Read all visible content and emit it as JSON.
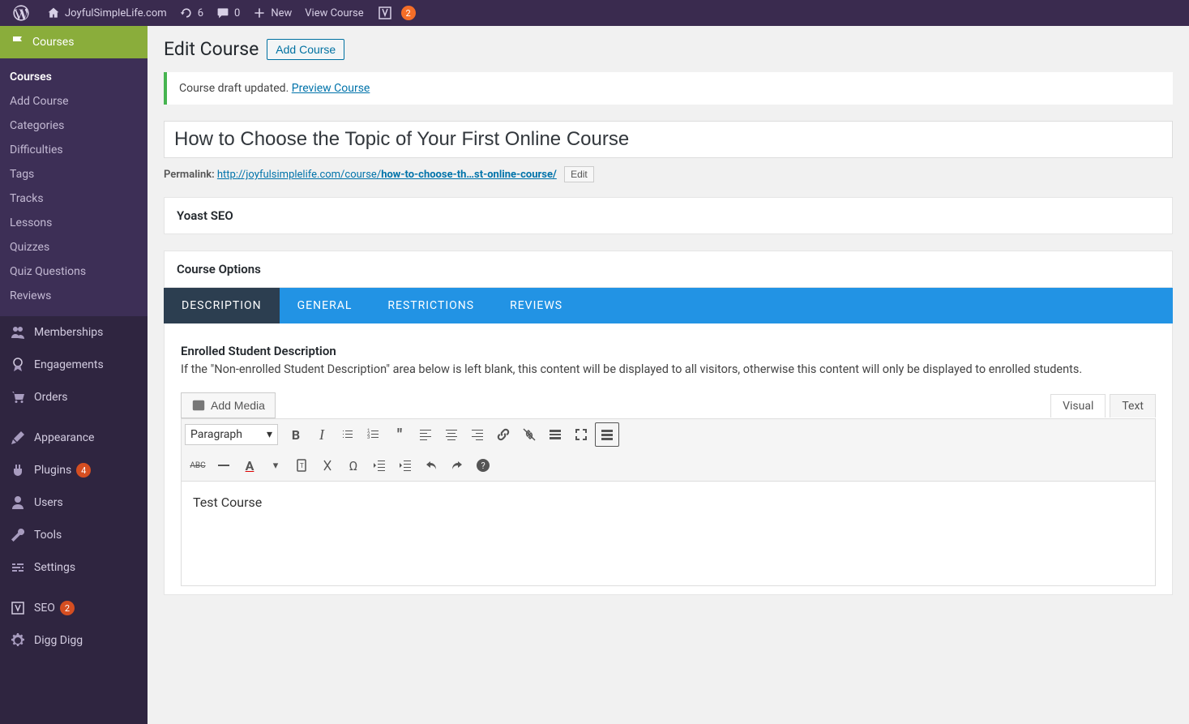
{
  "adminbar": {
    "site_name": "JoyfulSimpleLife.com",
    "updates_count": "6",
    "comments_count": "0",
    "new_label": "New",
    "view_label": "View Course",
    "yoast_count": "2"
  },
  "sidebar": {
    "current_menu": "Courses",
    "submenu": [
      {
        "label": "Courses",
        "current": true
      },
      {
        "label": "Add Course"
      },
      {
        "label": "Categories"
      },
      {
        "label": "Difficulties"
      },
      {
        "label": "Tags"
      },
      {
        "label": "Tracks"
      },
      {
        "label": "Lessons"
      },
      {
        "label": "Quizzes"
      },
      {
        "label": "Quiz Questions"
      },
      {
        "label": "Reviews"
      }
    ],
    "items": [
      {
        "icon": "users",
        "label": "Memberships"
      },
      {
        "icon": "award",
        "label": "Engagements"
      },
      {
        "icon": "cart",
        "label": "Orders"
      },
      {
        "sep": true
      },
      {
        "icon": "brush",
        "label": "Appearance"
      },
      {
        "icon": "plug",
        "label": "Plugins",
        "badge": "4"
      },
      {
        "icon": "user",
        "label": "Users"
      },
      {
        "icon": "wrench",
        "label": "Tools"
      },
      {
        "icon": "sliders",
        "label": "Settings"
      },
      {
        "sep": true
      },
      {
        "icon": "yoast",
        "label": "SEO",
        "badge": "2"
      },
      {
        "icon": "gear",
        "label": "Digg Digg"
      }
    ]
  },
  "page": {
    "heading": "Edit Course",
    "add_label": "Add Course",
    "notice_text": "Course draft updated. ",
    "notice_link": "Preview Course",
    "title_value": "How to Choose the Topic of Your First Online Course",
    "permalink_label": "Permalink:",
    "permalink_url_base": "http://joyfulsimplelife.com/course/",
    "permalink_slug": "how-to-choose-th…st-online-course/",
    "permalink_edit": "Edit"
  },
  "metaboxes": {
    "yoast_title": "Yoast SEO",
    "options_title": "Course Options"
  },
  "tabs": [
    {
      "label": "DESCRIPTION",
      "active": true
    },
    {
      "label": "GENERAL"
    },
    {
      "label": "RESTRICTIONS"
    },
    {
      "label": "REVIEWS"
    }
  ],
  "panel": {
    "title": "Enrolled Student Description",
    "desc": "If the \"Non-enrolled Student Description\" area below is left blank, this content will be displayed to all visitors, otherwise this content will only be displayed to enrolled students."
  },
  "editor": {
    "add_media": "Add Media",
    "tab_visual": "Visual",
    "tab_text": "Text",
    "format_select": "Paragraph",
    "content": "Test Course"
  }
}
